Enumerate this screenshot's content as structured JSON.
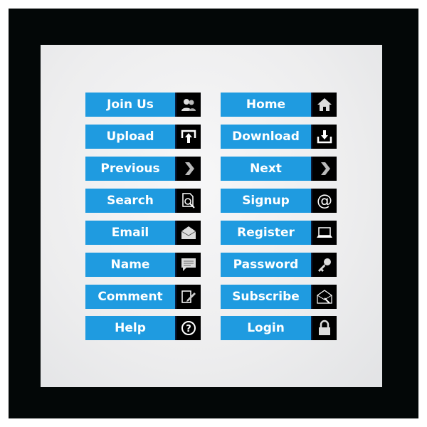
{
  "colors": {
    "button_blue": "#1f9be0",
    "icon_bg": "#000000",
    "frame": "#030707",
    "panel": "#ededee"
  },
  "buttons": {
    "left": [
      {
        "label": "Join Us",
        "icon": "users-icon"
      },
      {
        "label": "Upload",
        "icon": "upload-icon"
      },
      {
        "label": "Previous",
        "icon": "chevron-right-icon"
      },
      {
        "label": "Search",
        "icon": "document-search-icon"
      },
      {
        "label": "Email",
        "icon": "envelope-icon"
      },
      {
        "label": "Name",
        "icon": "speech-bubble-icon"
      },
      {
        "label": "Comment",
        "icon": "edit-document-icon"
      },
      {
        "label": "Help",
        "icon": "question-circle-icon"
      }
    ],
    "right": [
      {
        "label": "Home",
        "icon": "home-icon"
      },
      {
        "label": "Download",
        "icon": "download-icon"
      },
      {
        "label": "Next",
        "icon": "chevron-right-icon"
      },
      {
        "label": "Signup",
        "icon": "at-icon"
      },
      {
        "label": "Register",
        "icon": "laptop-icon"
      },
      {
        "label": "Password",
        "icon": "key-icon"
      },
      {
        "label": "Subscribe",
        "icon": "open-envelope-icon"
      },
      {
        "label": "Login",
        "icon": "padlock-icon"
      }
    ]
  }
}
